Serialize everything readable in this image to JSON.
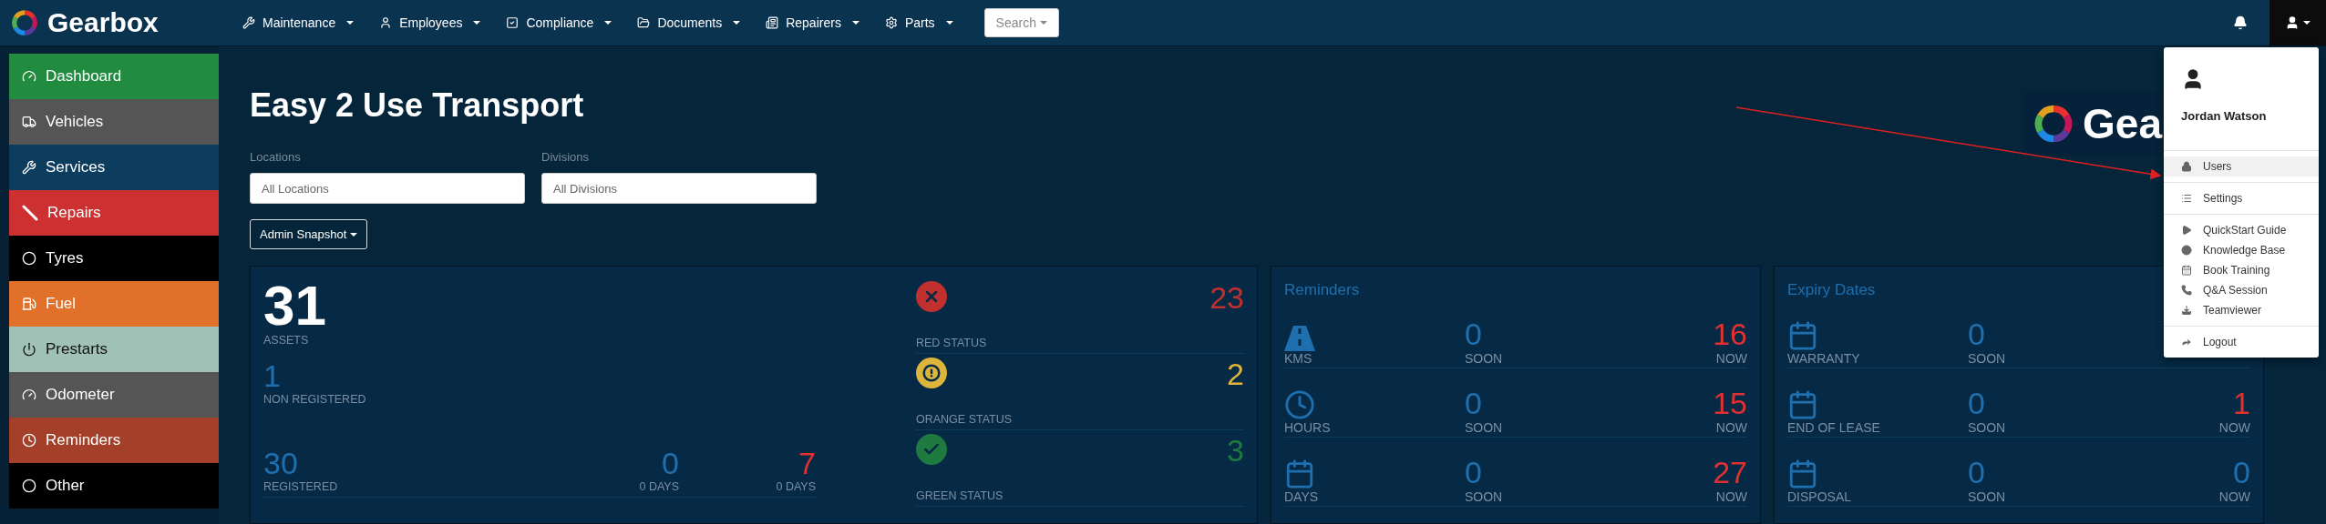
{
  "brand": {
    "name": "Gearbox"
  },
  "nav": [
    {
      "label": "Maintenance"
    },
    {
      "label": "Employees"
    },
    {
      "label": "Compliance"
    },
    {
      "label": "Documents"
    },
    {
      "label": "Repairers"
    },
    {
      "label": "Parts"
    }
  ],
  "search": {
    "label": "Search"
  },
  "sidebar": {
    "items": [
      {
        "label": "Dashboard",
        "color": "#218c3f"
      },
      {
        "label": "Vehicles",
        "color": "#555555"
      },
      {
        "label": "Services",
        "color": "#0c3c5e"
      },
      {
        "label": "Repairs",
        "color": "#cc3030"
      },
      {
        "label": "Tyres",
        "color": "#000000"
      },
      {
        "label": "Fuel",
        "color": "#e0702a"
      },
      {
        "label": "Prestarts",
        "color": "#9fc1b6"
      },
      {
        "label": "Odometer",
        "color": "#555555"
      },
      {
        "label": "Reminders",
        "color": "#a4402a"
      },
      {
        "label": "Other",
        "color": "#000000"
      }
    ]
  },
  "page": {
    "title": "Easy 2 Use Transport",
    "logo_text": "Gea",
    "filters": [
      {
        "label": "Locations",
        "placeholder": "All Locations"
      },
      {
        "label": "Divisions",
        "placeholder": "All Divisions"
      }
    ],
    "snapshot_button": "Admin Snapshot"
  },
  "assets": {
    "total": "31",
    "total_label": "ASSETS",
    "non_registered": "1",
    "non_registered_label": "NON REGISTERED",
    "registered": "30",
    "registered_label": "REGISTERED",
    "periods": [
      {
        "value": "0",
        "label": "0 DAYS",
        "alert": false
      },
      {
        "value": "7",
        "label": "0 DAYS",
        "alert": true
      }
    ]
  },
  "statuses": [
    {
      "kind": "cross",
      "label": "RED STATUS",
      "value": "23",
      "color": "#c0302f"
    },
    {
      "kind": "exclaim",
      "label": "ORANGE STATUS",
      "value": "2",
      "color": "#ddb43c"
    },
    {
      "kind": "check",
      "label": "GREEN STATUS",
      "value": "3",
      "color": "#1e7a3e"
    }
  ],
  "reminders": {
    "title": "Reminders",
    "rows": [
      {
        "kind": "road",
        "label": "KMS",
        "soon": "0",
        "soon_label": "SOON",
        "now": "16",
        "now_label": "NOW",
        "alert": true
      },
      {
        "kind": "clock",
        "label": "HOURS",
        "soon": "0",
        "soon_label": "SOON",
        "now": "15",
        "now_label": "NOW",
        "alert": true
      },
      {
        "kind": "calendar",
        "label": "DAYS",
        "soon": "0",
        "soon_label": "SOON",
        "now": "27",
        "now_label": "NOW",
        "alert": true
      }
    ]
  },
  "expiry": {
    "title": "Expiry Dates",
    "rows": [
      {
        "kind": "calendar",
        "label": "WARRANTY",
        "soon": "0",
        "soon_label": "SOON"
      },
      {
        "kind": "calendar",
        "label": "END OF LEASE",
        "soon": "0",
        "soon_label": "SOON",
        "now": "1",
        "now_label": "NOW",
        "alert": true
      },
      {
        "kind": "calendar",
        "label": "DISPOSAL",
        "soon": "0",
        "soon_label": "SOON",
        "now": "0",
        "now_label": "NOW",
        "alert": false
      }
    ]
  },
  "user_menu": {
    "name": "Jordan Watson",
    "sections": [
      [
        {
          "label": "Users",
          "selected": true
        }
      ],
      [
        {
          "label": "Settings",
          "selected": false
        }
      ],
      [
        {
          "label": "QuickStart Guide",
          "selected": false
        },
        {
          "label": "Knowledge Base",
          "selected": false
        },
        {
          "label": "Book Training",
          "selected": false
        },
        {
          "label": "Q&A Session",
          "selected": false
        },
        {
          "label": "Teamviewer",
          "selected": false
        }
      ],
      [
        {
          "label": "Logout",
          "selected": false
        }
      ]
    ]
  }
}
